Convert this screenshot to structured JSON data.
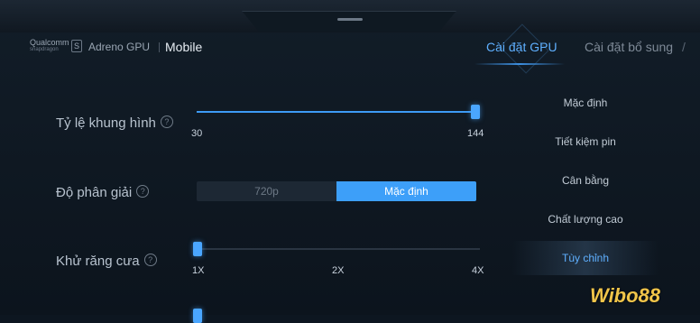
{
  "header": {
    "brand_qualcomm": "Qualcomm",
    "brand_snapdragon": "snapdragon",
    "brand_adreno": "Adreno GPU",
    "mode_label": "Mobile",
    "tabs": [
      {
        "label": "Cài đặt GPU",
        "active": true
      },
      {
        "label": "Cài đặt bổ sung",
        "active": false
      }
    ],
    "tab_trailing": "/"
  },
  "settings": {
    "frame_rate": {
      "label": "Tỷ lệ khung hình",
      "help": "?",
      "min_label": "30",
      "max_label": "144",
      "value_fraction": 1.0
    },
    "resolution": {
      "label": "Độ phân giải",
      "help": "?",
      "options": [
        "720p",
        "Mặc định"
      ],
      "selected": "Mặc định"
    },
    "anti_aliasing": {
      "label": "Khử răng cưa",
      "help": "?",
      "ticks": [
        "1X",
        "2X",
        "4X"
      ],
      "value_fraction": 0.0
    }
  },
  "presets": [
    {
      "label": "Mặc định",
      "active": false
    },
    {
      "label": "Tiết kiệm pin",
      "active": false
    },
    {
      "label": "Cân bằng",
      "active": false
    },
    {
      "label": "Chất lượng cao",
      "active": false
    },
    {
      "label": "Tùy chỉnh",
      "active": true
    }
  ],
  "watermark": {
    "text": "Wibo88"
  },
  "colors": {
    "accent": "#3d9ff9",
    "background": "#0d1620",
    "watermark": "#f1c54a"
  }
}
